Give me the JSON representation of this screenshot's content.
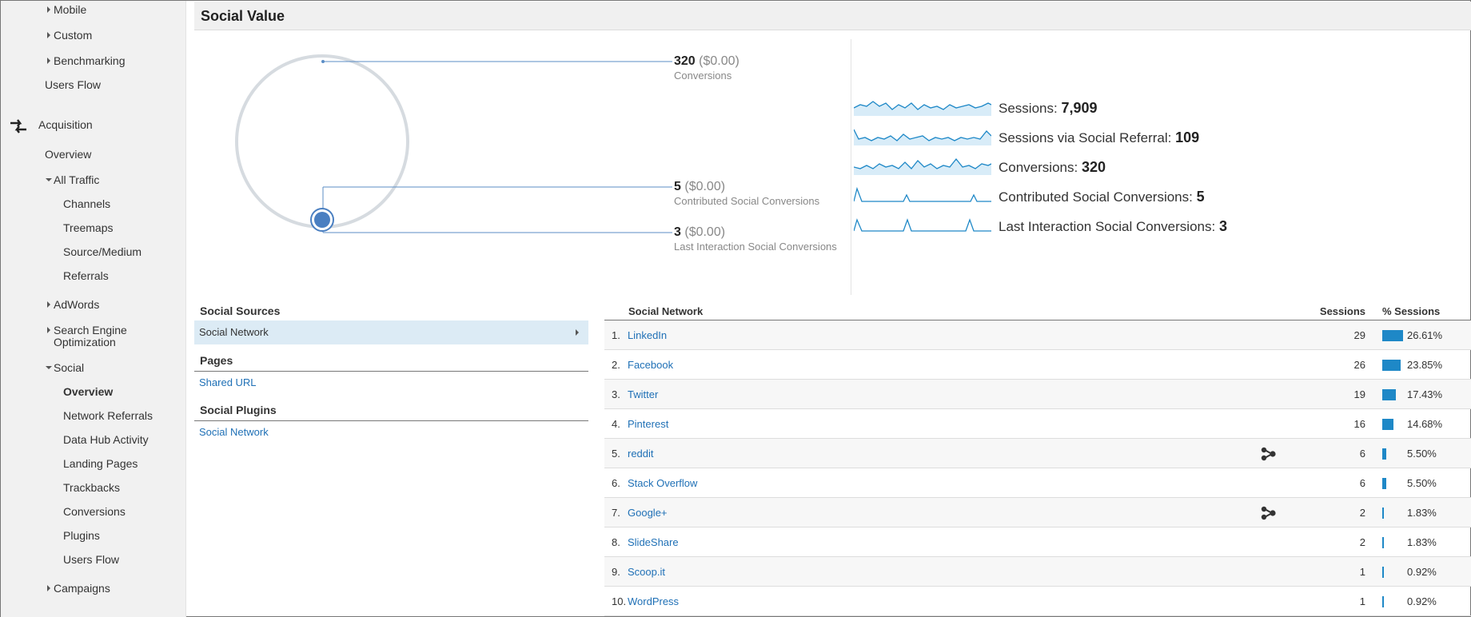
{
  "sidebar": {
    "mobile": "Mobile",
    "custom": "Custom",
    "benchmarking": "Benchmarking",
    "users_flow_top": "Users Flow",
    "acquisition": "Acquisition",
    "overview": "Overview",
    "all_traffic": "All Traffic",
    "channels": "Channels",
    "treemaps": "Treemaps",
    "source_medium": "Source/Medium",
    "referrals": "Referrals",
    "adwords": "AdWords",
    "seo_line1": "Search Engine",
    "seo_line2": "Optimization",
    "social": "Social",
    "social_overview": "Overview",
    "network_referrals": "Network Referrals",
    "data_hub": "Data Hub Activity",
    "landing_pages": "Landing Pages",
    "trackbacks": "Trackbacks",
    "conversions": "Conversions",
    "plugins": "Plugins",
    "users_flow": "Users Flow",
    "campaigns": "Campaigns"
  },
  "header": {
    "title": "Social Value"
  },
  "summary": {
    "conversions": {
      "value": "320",
      "money": "($0.00)",
      "label": "Conversions"
    },
    "contributed": {
      "value": "5",
      "money": "($0.00)",
      "label": "Contributed Social Conversions"
    },
    "last_interaction": {
      "value": "3",
      "money": "($0.00)",
      "label": "Last Interaction Social Conversions"
    }
  },
  "metrics": [
    {
      "label": "Sessions:",
      "value": "7,909"
    },
    {
      "label": "Sessions via Social Referral:",
      "value": "109"
    },
    {
      "label": "Conversions:",
      "value": "320"
    },
    {
      "label": "Contributed Social Conversions:",
      "value": "5"
    },
    {
      "label": "Last Interaction Social Conversions:",
      "value": "3"
    }
  ],
  "sources": {
    "social_sources": "Social Sources",
    "social_network": "Social Network",
    "pages": "Pages",
    "shared_url": "Shared URL",
    "social_plugins": "Social Plugins",
    "plugins_network": "Social Network"
  },
  "table": {
    "headers": {
      "network": "Social Network",
      "sessions": "Sessions",
      "pct": "% Sessions"
    },
    "rows": [
      {
        "num": "1.",
        "name": "LinkedIn",
        "sessions": "29",
        "pct": "26.61%",
        "share": 26.61,
        "hub": false
      },
      {
        "num": "2.",
        "name": "Facebook",
        "sessions": "26",
        "pct": "23.85%",
        "share": 23.85,
        "hub": false
      },
      {
        "num": "3.",
        "name": "Twitter",
        "sessions": "19",
        "pct": "17.43%",
        "share": 17.43,
        "hub": false
      },
      {
        "num": "4.",
        "name": "Pinterest",
        "sessions": "16",
        "pct": "14.68%",
        "share": 14.68,
        "hub": false
      },
      {
        "num": "5.",
        "name": "reddit",
        "sessions": "6",
        "pct": "5.50%",
        "share": 5.5,
        "hub": true
      },
      {
        "num": "6.",
        "name": "Stack Overflow",
        "sessions": "6",
        "pct": "5.50%",
        "share": 5.5,
        "hub": false
      },
      {
        "num": "7.",
        "name": "Google+",
        "sessions": "2",
        "pct": "1.83%",
        "share": 1.83,
        "hub": true
      },
      {
        "num": "8.",
        "name": "SlideShare",
        "sessions": "2",
        "pct": "1.83%",
        "share": 1.83,
        "hub": false
      },
      {
        "num": "9.",
        "name": "Scoop.it",
        "sessions": "1",
        "pct": "0.92%",
        "share": 0.92,
        "hub": false
      },
      {
        "num": "10.",
        "name": "WordPress",
        "sessions": "1",
        "pct": "0.92%",
        "share": 0.92,
        "hub": false
      }
    ]
  },
  "colors": {
    "accent": "#1e88c7",
    "link": "#1f70b6",
    "selected_bg": "#dcebf5"
  },
  "icons": {
    "acquisition": "acquisition-arrows-icon",
    "hub": "data-hub-icon"
  }
}
